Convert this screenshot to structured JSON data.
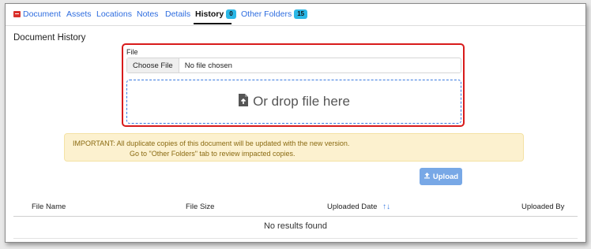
{
  "tabs": [
    {
      "label": "Document"
    },
    {
      "label": "Assets"
    },
    {
      "label": "Locations"
    },
    {
      "label": "Notes"
    },
    {
      "label": "Details"
    },
    {
      "label": "History",
      "badge": "0"
    },
    {
      "label": "Other Folders",
      "badge": "15"
    }
  ],
  "active_tab": "History",
  "page": {
    "title": "Document History"
  },
  "upload_form": {
    "field_label": "File",
    "choose_button": "Choose File",
    "file_status": "No file chosen",
    "dropzone_text": "Or drop file here"
  },
  "notice": {
    "line1": "IMPORTANT: All duplicate copies of this document will be updated with the new version.",
    "line2": "Go to \"Other Folders\" tab to review impacted copies."
  },
  "upload_button": {
    "label": "Upload"
  },
  "table": {
    "columns": [
      "File Name",
      "File Size",
      "Uploaded Date",
      "Uploaded By"
    ],
    "empty_message": "No results found"
  },
  "colors": {
    "link": "#2d6cdf",
    "highlight_border": "#d81b1b",
    "badge": "#2bb7e6",
    "notice_bg": "#fcf1cf",
    "upload_button": "#78a8e6"
  },
  "icons": {
    "document_tab": "document-icon",
    "dropzone": "file-upload-icon",
    "upload_button": "upload-icon",
    "sort": "sort-arrows-icon"
  }
}
